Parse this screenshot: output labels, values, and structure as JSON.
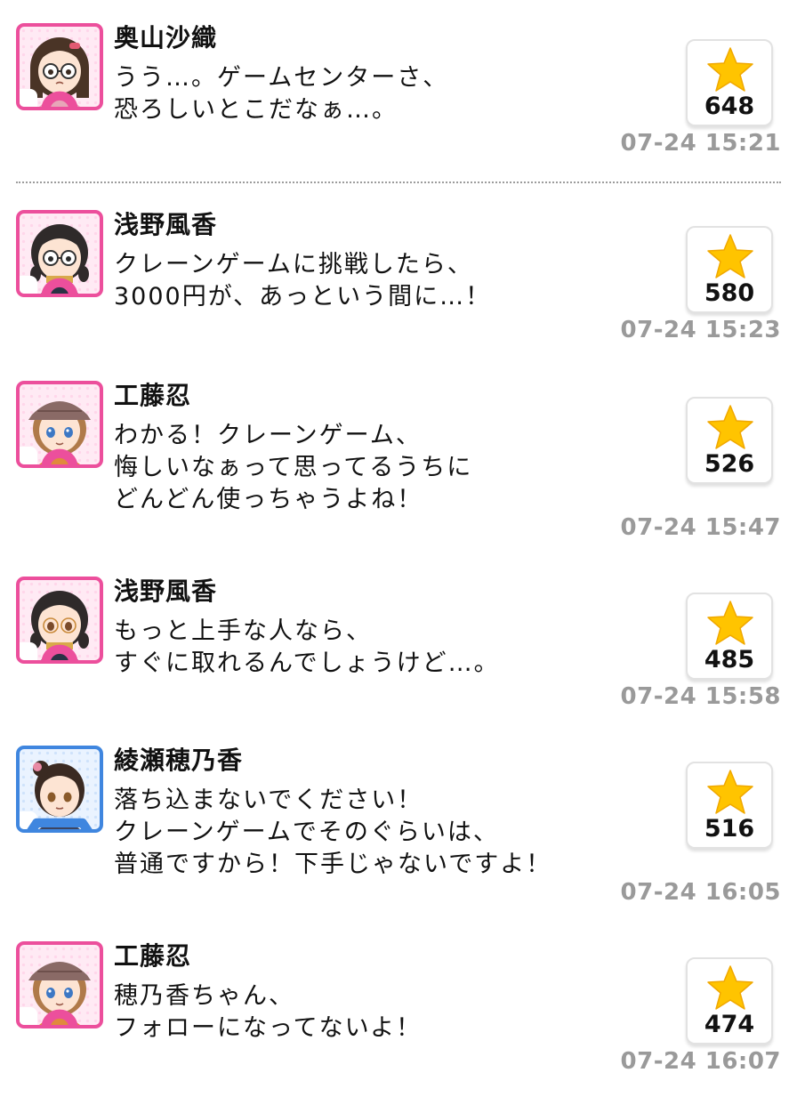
{
  "posts": [
    {
      "name": "奥山沙織",
      "lines": "うう…。ゲームセンターさ、\n恐ろしいとこだなぁ…。",
      "likes": "648",
      "time": "07-24 15:21"
    },
    {
      "name": "浅野風香",
      "lines": "クレーンゲームに挑戦したら、\n3000円が、あっという間に…！",
      "likes": "580",
      "time": "07-24 15:23"
    },
    {
      "name": "工藤忍",
      "lines": "わかる！クレーンゲーム、\n悔しいなぁって思ってるうちに\nどんどん使っちゃうよね！",
      "likes": "526",
      "time": "07-24 15:47"
    },
    {
      "name": "浅野風香",
      "lines": "もっと上手な人なら、\nすぐに取れるんでしょうけど…。",
      "likes": "485",
      "time": "07-24 15:58"
    },
    {
      "name": "綾瀬穂乃香",
      "lines": "落ち込まないでください！\nクレーンゲームでそのぐらいは、\n普通ですから！下手じゃないですよ！",
      "likes": "516",
      "time": "07-24 16:05"
    },
    {
      "name": "工藤忍",
      "lines": "穂乃香ちゃん、\nフォローになってないよ！",
      "likes": "474",
      "time": "07-24 16:07"
    }
  ],
  "colors": {
    "cute": "#ec4f9c",
    "cool": "#3f86df",
    "star": "#ffc400",
    "timestamp": "#9a9a9a"
  },
  "icons": {
    "like": "star-icon",
    "cute_badge": "flower-badge-icon",
    "cool_badge": "diamond-badge-icon"
  }
}
